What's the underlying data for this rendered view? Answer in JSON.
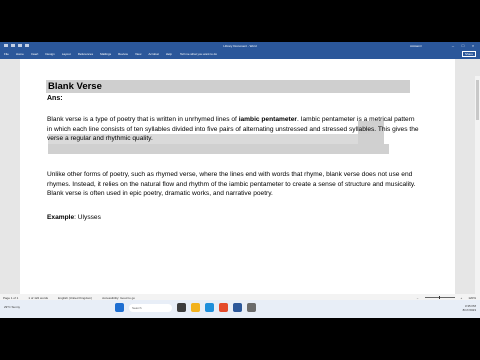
{
  "window": {
    "title": "Library Document - Word",
    "user": "AAAamir",
    "share_label": "Share"
  },
  "ribbon": {
    "tabs": [
      "File",
      "Home",
      "Insert",
      "Design",
      "Layout",
      "References",
      "Mailings",
      "Review",
      "View",
      "Acrobat",
      "Help"
    ],
    "tellme": "Tell me what you want to do"
  },
  "document": {
    "heading": "Blank Verse",
    "ans": "Ans:",
    "p1_a": "Blank verse is a type of poetry that is written in unrhymed lines of ",
    "p1_bold": "iambic pentameter",
    "p1_b": ". Iambic pentameter is a metrical pattern in which each line consists of ten syllables divided into five pairs of alternating unstressed and stressed syllables. This gives the verse a regular and rhythmic quality.",
    "p2": "Unlike other forms of poetry, such as rhymed verse, where the lines end with words that rhyme, blank verse does not use end rhymes. Instead, it relies on the natural flow and rhythm of the iambic pentameter to create a sense of structure and musicality. Blank verse is often used in epic poetry, dramatic works, and narrative poetry.",
    "example_label": "Example",
    "example_value": ": Ulysses"
  },
  "status": {
    "page": "Page 1 of 1",
    "words": "1 of 122 words",
    "lang": "English (United Kingdom)",
    "accessibility": "Accessibility: Good to go",
    "zoom": "120%"
  },
  "taskbar": {
    "weather": "29°C Sunny",
    "search_placeholder": "Search",
    "time": "3:35 PM",
    "date": "8/17/2023"
  },
  "colors": {
    "accent": "#2b579a",
    "highlight": "#d0d0d0"
  }
}
